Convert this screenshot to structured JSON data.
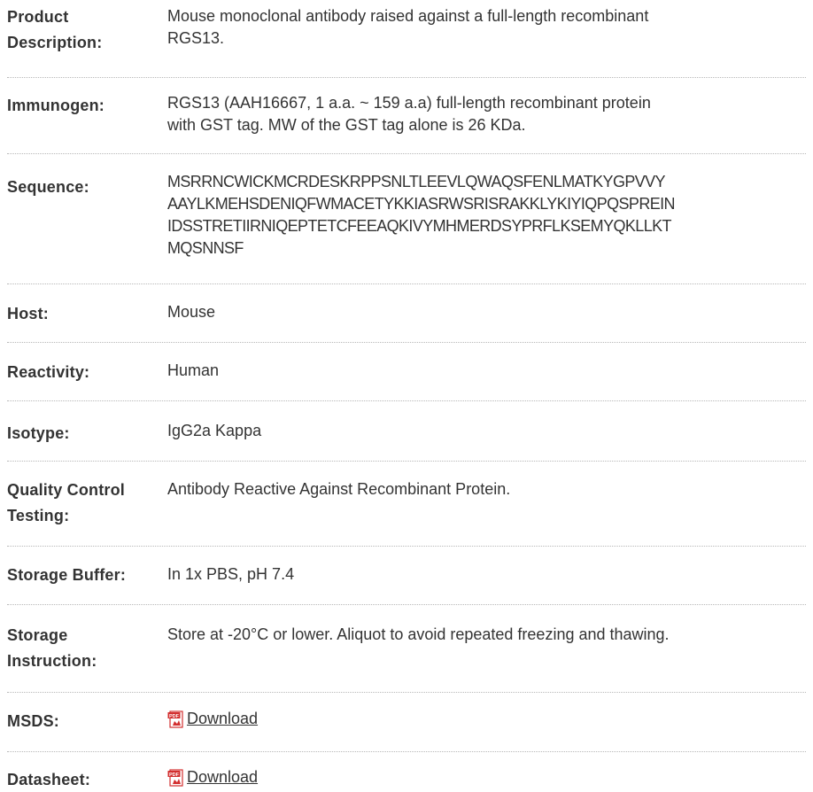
{
  "rows": {
    "product_description": {
      "label_line1": "Product",
      "label_line2": "Description:",
      "value_line1": "Mouse monoclonal antibody raised against a full-length recombinant",
      "value_line2": "RGS13."
    },
    "immunogen": {
      "label": "Immunogen:",
      "value_line1": "RGS13 (AAH16667, 1 a.a. ~ 159 a.a) full-length recombinant protein",
      "value_line2": "with GST tag. MW of the GST tag alone is 26 KDa."
    },
    "sequence": {
      "label": "Sequence:",
      "lines": [
        "MSRRNCWICKMCRDESKRPPSNLTLEEVLQWAQSFENLMATKYGPVVY",
        "AAYLKMEHSDENIQFWMACETYKKIASRWSRISRAKKLYKIYIQPQSPREIN",
        "IDSSTRETIIRNIQEPTETCFEEAQKIVYMHMERDSYPRFLKSEMYQKLLKT",
        "MQSNNSF"
      ]
    },
    "host": {
      "label": "Host:",
      "value": "Mouse"
    },
    "reactivity": {
      "label": "Reactivity:",
      "value": "Human"
    },
    "isotype": {
      "label": "Isotype:",
      "value": "IgG2a Kappa"
    },
    "quality_control": {
      "label_line1": "Quality Control",
      "label_line2": "Testing:",
      "value": "Antibody Reactive Against Recombinant Protein."
    },
    "storage_buffer": {
      "label": "Storage Buffer:",
      "value": "In 1x PBS, pH 7.4"
    },
    "storage_instruction": {
      "label_line1": "Storage",
      "label_line2": "Instruction:",
      "value": "Store at -20°C or lower. Aliquot to avoid repeated freezing and thawing."
    },
    "msds": {
      "label": "MSDS:",
      "link_text": "Download",
      "icon": "pdf-icon"
    },
    "datasheet": {
      "label": "Datasheet:",
      "link_text": "Download",
      "icon": "pdf-icon"
    }
  },
  "colors": {
    "text": "#333333",
    "separator": "#b8b8b8",
    "pdf_red": "#d32f2f"
  }
}
